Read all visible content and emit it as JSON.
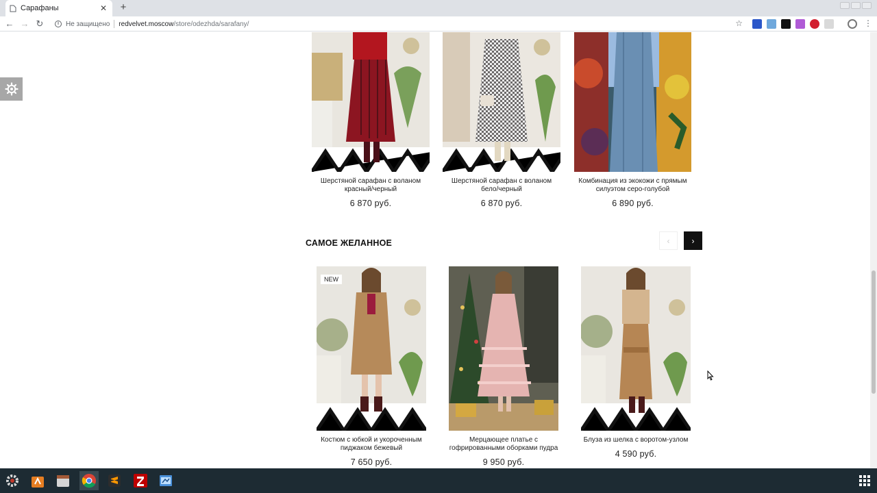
{
  "browser": {
    "tab_title": "Сарафаны",
    "security_label": "Не защищено",
    "url_domain": "redvelvet.moscow",
    "url_path": "/store/odezhda/sarafany/"
  },
  "products_top": [
    {
      "name": "Шерстяной сарафан с воланом красный/черный",
      "price": "6 870 руб."
    },
    {
      "name": "Шерстяной сарафан с воланом бело/черный",
      "price": "6 870 руб."
    },
    {
      "name": "Комбинация из экокожи с прямым силуэтом серо-голубой",
      "price": "6 890 руб."
    }
  ],
  "wishlist_section": {
    "title": "САМОЕ ЖЕЛАННОЕ",
    "prev_icon": "‹",
    "next_icon": "›",
    "products": [
      {
        "badge": "NEW",
        "name": "Костюм с юбкой и укороченным пиджаком бежевый",
        "price": "7 650 руб."
      },
      {
        "badge": "",
        "name": "Мерцающее платье с гофрированными оборками пудра",
        "price": "9 950 руб."
      },
      {
        "badge": "",
        "name": "Блуза из шелка с воротом-узлом",
        "price": "4 590 руб."
      }
    ]
  },
  "colors": {
    "accent": "#111111",
    "taskbar": "#1d2b33"
  }
}
